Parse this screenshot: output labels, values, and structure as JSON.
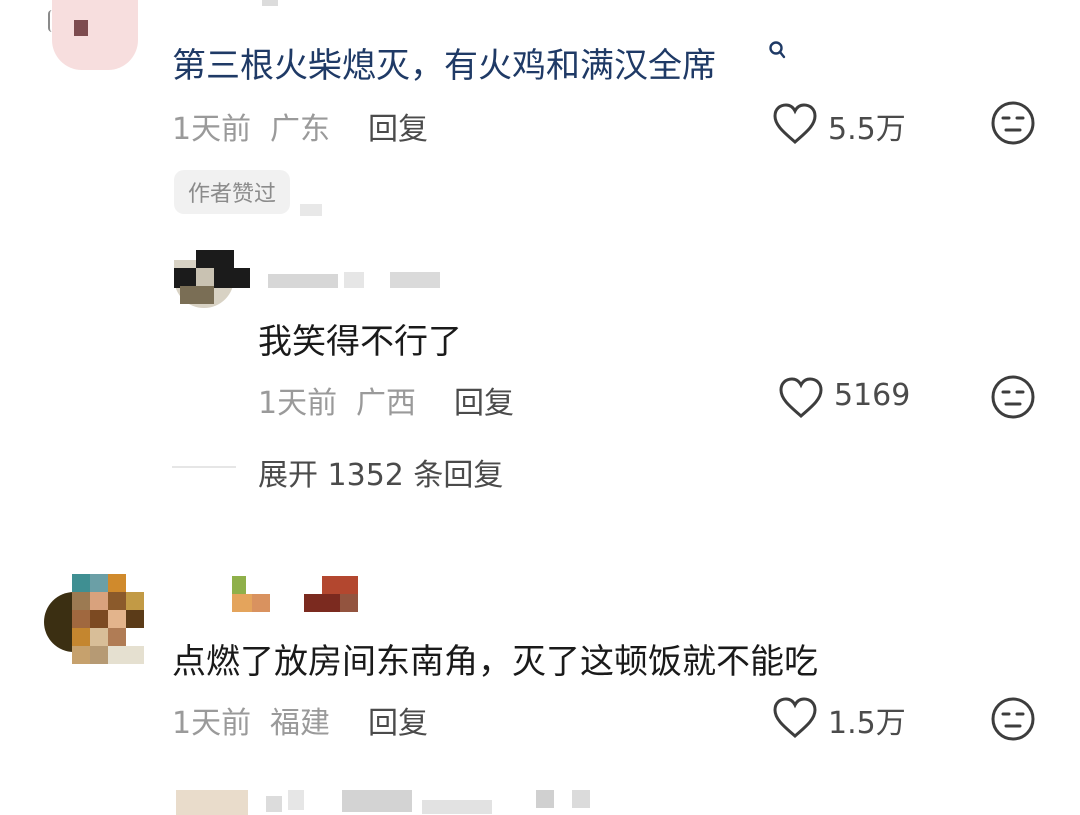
{
  "comments": [
    {
      "text": "第三根火柴熄灭，有火鸡和满汉全席",
      "time": "1天前",
      "location": "广东",
      "reply_label": "回复",
      "likes": "5.5万",
      "badge": "作者赞过",
      "link_color": "#1f3a66",
      "replies": [
        {
          "text": "我笑得不行了",
          "time": "1天前",
          "location": "广西",
          "reply_label": "回复",
          "likes": "5169"
        }
      ],
      "expand_label": "展开 1352 条回复"
    },
    {
      "text": "点燃了放房间东南角，灭了这顿饭就不能吃",
      "time": "1天前",
      "location": "福建",
      "reply_label": "回复",
      "likes": "1.5万"
    }
  ],
  "icons": {
    "like": "heart-outline-icon",
    "dislike": "neutral-face-icon",
    "search": "search-magnifier-icon"
  },
  "colors": {
    "text": "#1a1a1a",
    "link_text": "#1f3a66",
    "meta": "#9a9a9a",
    "action": "#4b4b4b"
  }
}
